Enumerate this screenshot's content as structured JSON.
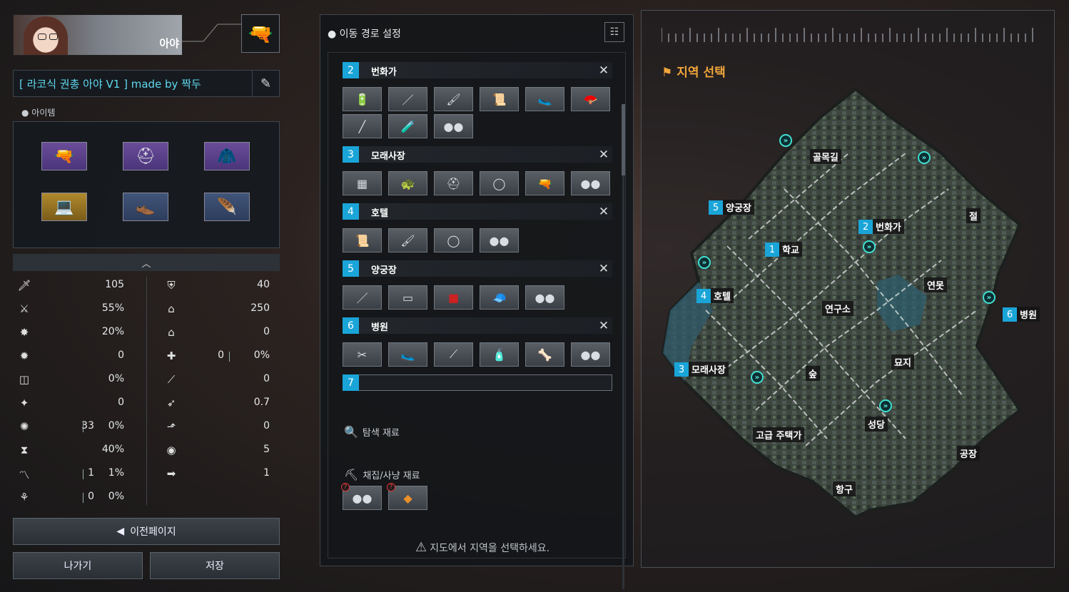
{
  "character": {
    "name": "아야"
  },
  "build": {
    "title": "[ 라코식 권총 아야 V1 ] made by 짝두"
  },
  "items": {
    "label": "아이템",
    "equipment": [
      {
        "icon": "pistol-icon",
        "rarity": "purple"
      },
      {
        "icon": "helmet-icon",
        "rarity": "purple"
      },
      {
        "icon": "jacket-icon",
        "rarity": "purple"
      },
      {
        "icon": "laptop-icon",
        "rarity": "gold"
      },
      {
        "icon": "boots-icon",
        "rarity": "blue"
      },
      {
        "icon": "feather-icon",
        "rarity": "blue"
      }
    ]
  },
  "stats": {
    "left": [
      {
        "icon": "attack-icon",
        "value": "105"
      },
      {
        "icon": "attack-speed-icon",
        "value": "55%"
      },
      {
        "icon": "critical-icon",
        "value": "20%"
      },
      {
        "icon": "critical-damage-icon",
        "value": "0"
      },
      {
        "icon": "lifesteal-icon",
        "value": "0%"
      },
      {
        "icon": "skill-amp-icon",
        "value": "0"
      },
      {
        "icon": "extra-damage-icon",
        "value": "33",
        "value2": "0%"
      },
      {
        "icon": "cooldown-icon",
        "value": "40%"
      },
      {
        "icon": "armor-pen-icon",
        "value": "1",
        "value2": "1%"
      },
      {
        "icon": "omnisyphon-icon",
        "value": "0",
        "value2": "0%"
      }
    ],
    "right": [
      {
        "icon": "defense-icon",
        "value": "40"
      },
      {
        "icon": "hp-icon",
        "value": "250"
      },
      {
        "icon": "hp-regen-icon",
        "value": "0"
      },
      {
        "icon": "heal-icon",
        "value": "0",
        "value2": "0%"
      },
      {
        "icon": "sp-regen-icon",
        "value": "0"
      },
      {
        "icon": "move-speed-icon",
        "value": "0.7"
      },
      {
        "icon": "out-combat-speed-icon",
        "value": "0"
      },
      {
        "icon": "vision-icon",
        "value": "5"
      },
      {
        "icon": "range-icon",
        "value": "1"
      }
    ]
  },
  "buttons": {
    "prev": "이전페이지",
    "exit": "나가기",
    "save": "저장"
  },
  "route": {
    "title": "이동 경로 설정",
    "stops": [
      {
        "num": "2",
        "name": "번화가",
        "slots": [
          "battery",
          "pen",
          "brush",
          "scroll",
          "slippers",
          "fan",
          "pen2",
          "bottle",
          "stones"
        ]
      },
      {
        "num": "3",
        "name": "모래사장",
        "slots": [
          "plank",
          "turtle-shell",
          "helmet",
          "plate",
          "pistol",
          "stones"
        ]
      },
      {
        "num": "4",
        "name": "호텔",
        "slots": [
          "scroll",
          "brush",
          "plate",
          "stones"
        ]
      },
      {
        "num": "5",
        "name": "양궁장",
        "slots": [
          "pen",
          "paper",
          "red-cloth",
          "cap",
          "stones"
        ]
      },
      {
        "num": "6",
        "name": "병원",
        "slots": [
          "scissors",
          "slippers",
          "chopsticks",
          "tube",
          "horn",
          "stones"
        ]
      },
      {
        "num": "7",
        "name": ""
      }
    ],
    "search_label": "탐색 재료",
    "gather_label": "채집/사냥 재료",
    "gather_marks": [
      "?",
      "?"
    ],
    "warning": "지도에서 지역을 선택하세요."
  },
  "map": {
    "title": "지역 선택",
    "areas": [
      {
        "name": "골목길"
      },
      {
        "name": "양궁장",
        "num": "5"
      },
      {
        "name": "번화가",
        "num": "2"
      },
      {
        "name": "절"
      },
      {
        "name": "학교",
        "num": "1"
      },
      {
        "name": "호텔",
        "num": "4"
      },
      {
        "name": "연구소"
      },
      {
        "name": "연못"
      },
      {
        "name": "병원",
        "num": "6"
      },
      {
        "name": "모래사장",
        "num": "3"
      },
      {
        "name": "숲"
      },
      {
        "name": "묘지"
      },
      {
        "name": "성당"
      },
      {
        "name": "고급 주택가"
      },
      {
        "name": "공장"
      },
      {
        "name": "항구"
      }
    ]
  }
}
